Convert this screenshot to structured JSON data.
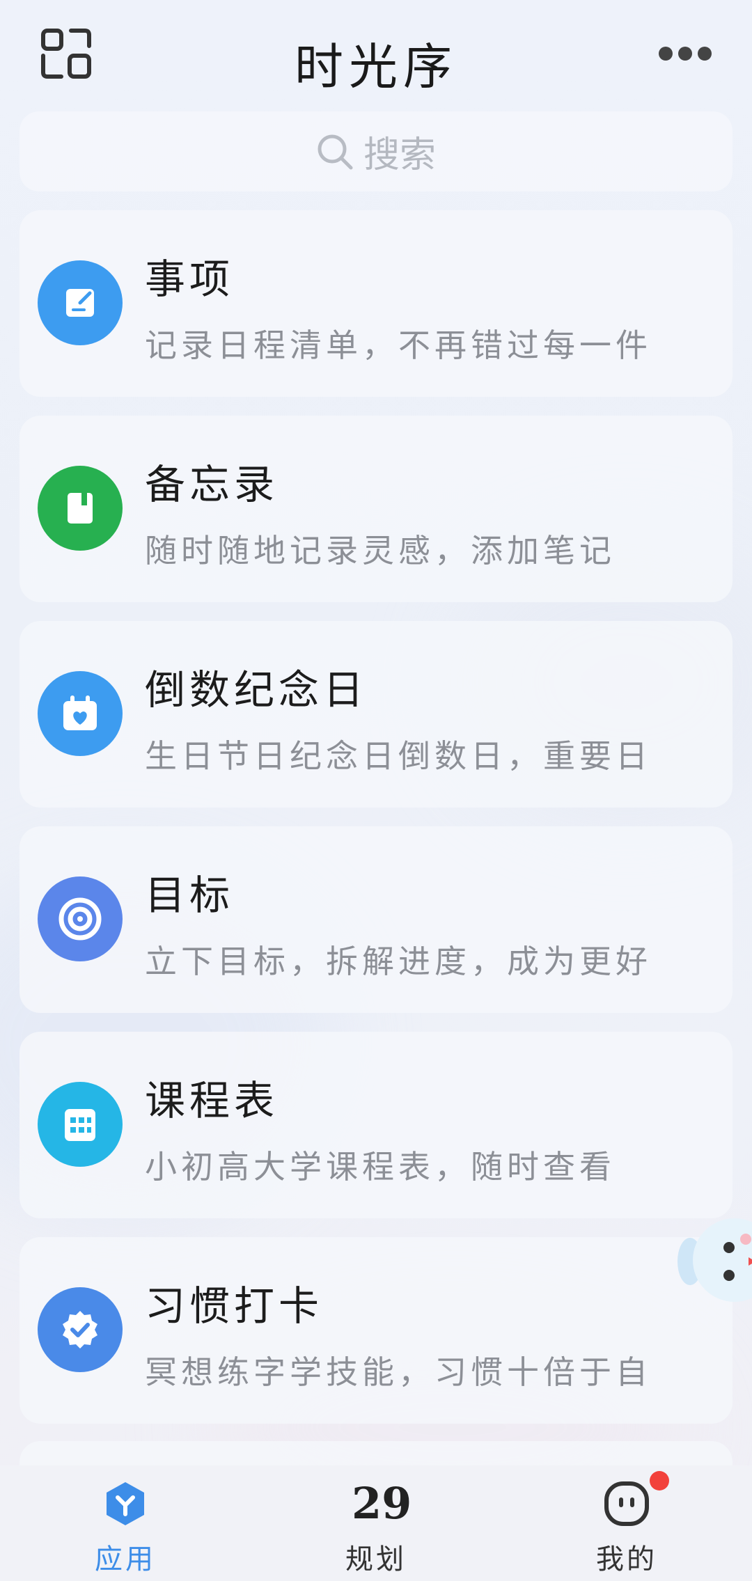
{
  "header": {
    "title": "时光序",
    "scan_icon": "scan-icon",
    "more_icon": "more-icon"
  },
  "search": {
    "placeholder": "搜索",
    "icon": "search-icon"
  },
  "apps": [
    {
      "title": "事项",
      "desc": "记录日程清单，不再错过每一件",
      "icon": "edit-note-icon",
      "color": "#3d9cf0"
    },
    {
      "title": "备忘录",
      "desc": "随时随地记录灵感，添加笔记",
      "icon": "notebook-icon",
      "color": "#27b050"
    },
    {
      "title": "倒数纪念日",
      "desc": "生日节日纪念日倒数日，重要日",
      "icon": "calendar-heart-icon",
      "color": "#3d9cf0"
    },
    {
      "title": "目标",
      "desc": "立下目标，拆解进度，成为更好",
      "icon": "target-icon",
      "color": "#5b86ea"
    },
    {
      "title": "课程表",
      "desc": "小初高大学课程表，随时查看",
      "icon": "timetable-icon",
      "color": "#25b6e6"
    },
    {
      "title": "习惯打卡",
      "desc": "冥想练字学技能，习惯十倍于自",
      "icon": "check-badge-icon",
      "color": "#4a8ae8"
    }
  ],
  "tabs": [
    {
      "label": "应用",
      "icon": "apps-icon",
      "active": true
    },
    {
      "label": "规划",
      "icon": "plan-icon",
      "number": "29",
      "active": false
    },
    {
      "label": "我的",
      "icon": "profile-icon",
      "active": false,
      "badge": true
    }
  ],
  "colors": {
    "accent": "#3d8de8",
    "badge": "#f2413b"
  }
}
